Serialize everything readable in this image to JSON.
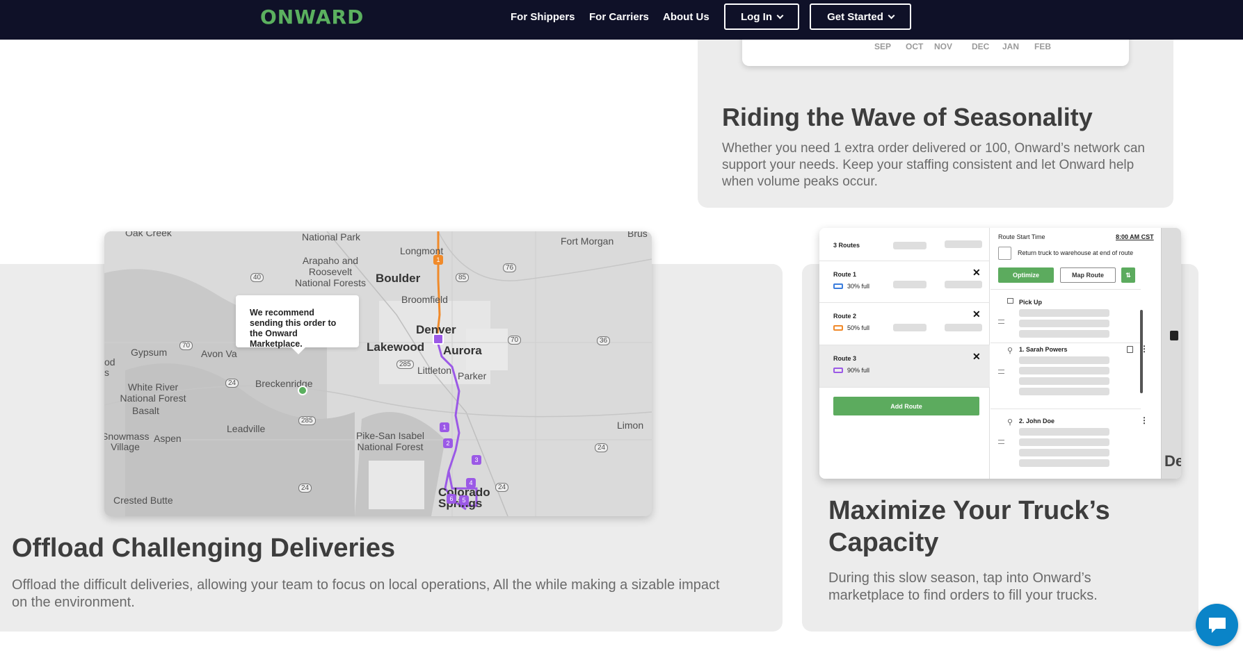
{
  "nav": {
    "logo": "ONWARD",
    "links": [
      "For Shippers",
      "For Carriers",
      "About Us"
    ],
    "login_label": "Log In",
    "get_started_label": "Get Started"
  },
  "season": {
    "months": [
      "SEP",
      "OCT",
      "NOV",
      "DEC",
      "JAN",
      "FEB"
    ],
    "title": "Riding the Wave of Seasonality",
    "text": "Whether you need 1 extra order delivered or 100, Onward’s network can support your needs. Keep your staffing consistent and let Onward help when volume peaks occur."
  },
  "offload": {
    "title": "Offload Challenging Deliveries",
    "text": "Offload the difficult deliveries, allowing your team to focus on local operations, All the while making a sizable impact on the environment.",
    "map": {
      "tooltip": "We recommend sending this order to the Onward Marketplace.",
      "labels": {
        "oak_creek": "Oak Creek",
        "national_park": "National Park",
        "longmont": "Longmont",
        "fort_morgan": "Fort Morgan",
        "brush": "Brus",
        "arapaho": "Arapaho and Roosevelt National Forests",
        "boulder": "Boulder",
        "broomfield": "Broomfield",
        "denver": "Denver",
        "lakewood": "Lakewood",
        "aurora": "Aurora",
        "gypsum": "Gypsum",
        "avon": "Avon Va",
        "littleton": "Littleton",
        "parker": "Parker",
        "breckenridge": "Breckenridge",
        "white_river": "White River National Forest",
        "basalt": "Basalt",
        "leadville": "Leadville",
        "pike_san_isabel": "Pike-San Isabel National Forest",
        "limon": "Limon",
        "snowmass": "Snowmass Village",
        "aspen": "Aspen",
        "crested_butte": "Crested Butte",
        "colorado_springs": "Colorado Springs",
        "od": "od",
        "s": "s"
      },
      "highways": [
        "40",
        "85",
        "76",
        "70",
        "70",
        "36",
        "285",
        "24",
        "285",
        "24",
        "24",
        "24"
      ],
      "stops": [
        "1",
        "2",
        "3",
        "4",
        "5",
        "6"
      ]
    }
  },
  "maximize": {
    "title": "Maximize Your Truck’s Capacity",
    "text": "During this slow season, tap into Onward’s marketplace to find orders to fill your trucks.",
    "app": {
      "routes_header": "3 Routes",
      "routes": [
        {
          "name": "Route 1",
          "fill": "30% full",
          "color": "#3b7ddd"
        },
        {
          "name": "Route 2",
          "fill": "50% full",
          "color": "#f08a2a"
        },
        {
          "name": "Route 3",
          "fill": "90% full",
          "color": "#9b59e6"
        }
      ],
      "add_route": "Add Route",
      "start_time_label": "Route Start Time",
      "start_time_value": "8:00 AM CST",
      "return_checkbox": "Return truck to warehouse at end of route",
      "optimize": "Optimize",
      "map_route": "Map Route",
      "pickup": "Pick Up",
      "stop1": "1.  Sarah Powers",
      "stop2": "2.  John Doe",
      "map_peek": "De"
    }
  },
  "colors": {
    "nav_bg": "#0f1128",
    "brand_green": "#5bb05f",
    "card_bg": "#ececec",
    "route_purple": "#9b59e6",
    "route_orange": "#f08a2a",
    "chat_blue": "#0a84c8"
  }
}
